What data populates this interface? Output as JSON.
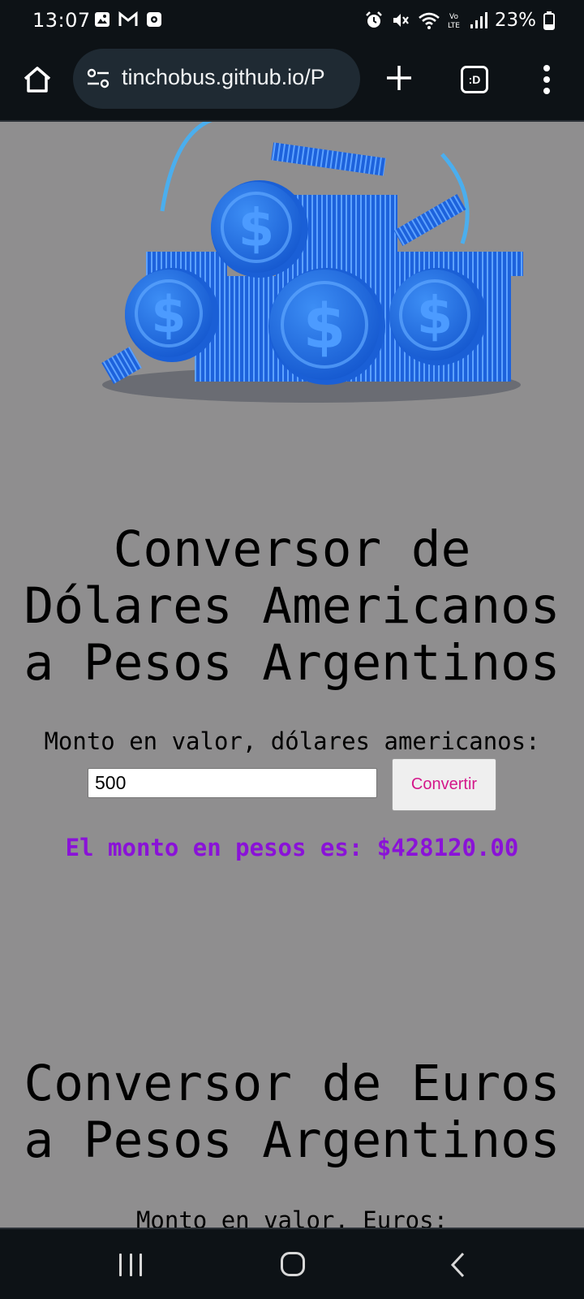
{
  "status_bar": {
    "time": "13:07",
    "battery_percent": "23%",
    "notification_icons": [
      "gallery-icon",
      "gmail-icon",
      "media-icon"
    ],
    "system_icons": [
      "alarm-icon",
      "mute-icon",
      "wifi-icon",
      "volte-icon",
      "signal-icon",
      "battery-icon"
    ]
  },
  "browser": {
    "url": "tinchobus.github.io/P",
    "tab_switcher_label": ":D"
  },
  "colors": {
    "page_background": "#8f8e8f",
    "result_text": "#8a12d8",
    "button_text": "#d4178a",
    "coin_blue": "#1f6fe0"
  },
  "usd_section": {
    "title": "Conversor de Dólares Americanos a Pesos Argentinos",
    "amount_label": "Monto en valor, dólares americanos:",
    "amount_value": "500",
    "convert_label": "Convertir",
    "result_text": "El monto en pesos es: $428120.00"
  },
  "eur_section": {
    "title": "Conversor de Euros a Pesos Argentinos",
    "amount_label": "Monto en valor, Euros:"
  }
}
